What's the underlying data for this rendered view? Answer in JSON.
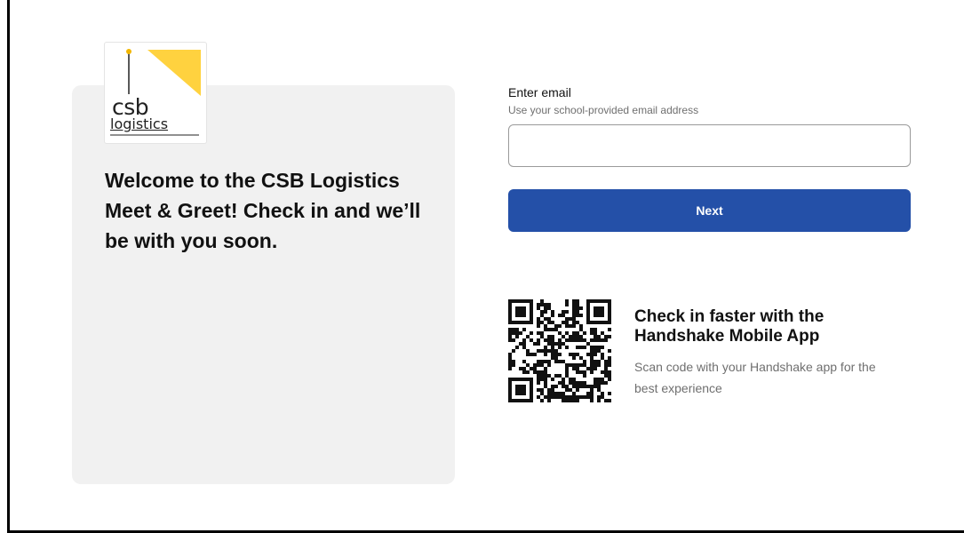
{
  "brand": {
    "logo_line1": "csb",
    "logo_line2": "logistics",
    "accent_color": "#ffd23f"
  },
  "welcome": {
    "message": "Welcome to the CSB Logistics Meet & Greet! Check in and we’ll be with you soon."
  },
  "form": {
    "email_label": "Enter email",
    "email_hint": "Use your school-provided email address",
    "email_value": "",
    "email_placeholder": "",
    "next_label": "Next",
    "button_color": "#2450a8"
  },
  "app_promo": {
    "title": "Check in faster with the Handshake Mobile App",
    "description": "Scan code with your Handshake app for the best experience",
    "qr_icon": "qr-code-icon"
  }
}
